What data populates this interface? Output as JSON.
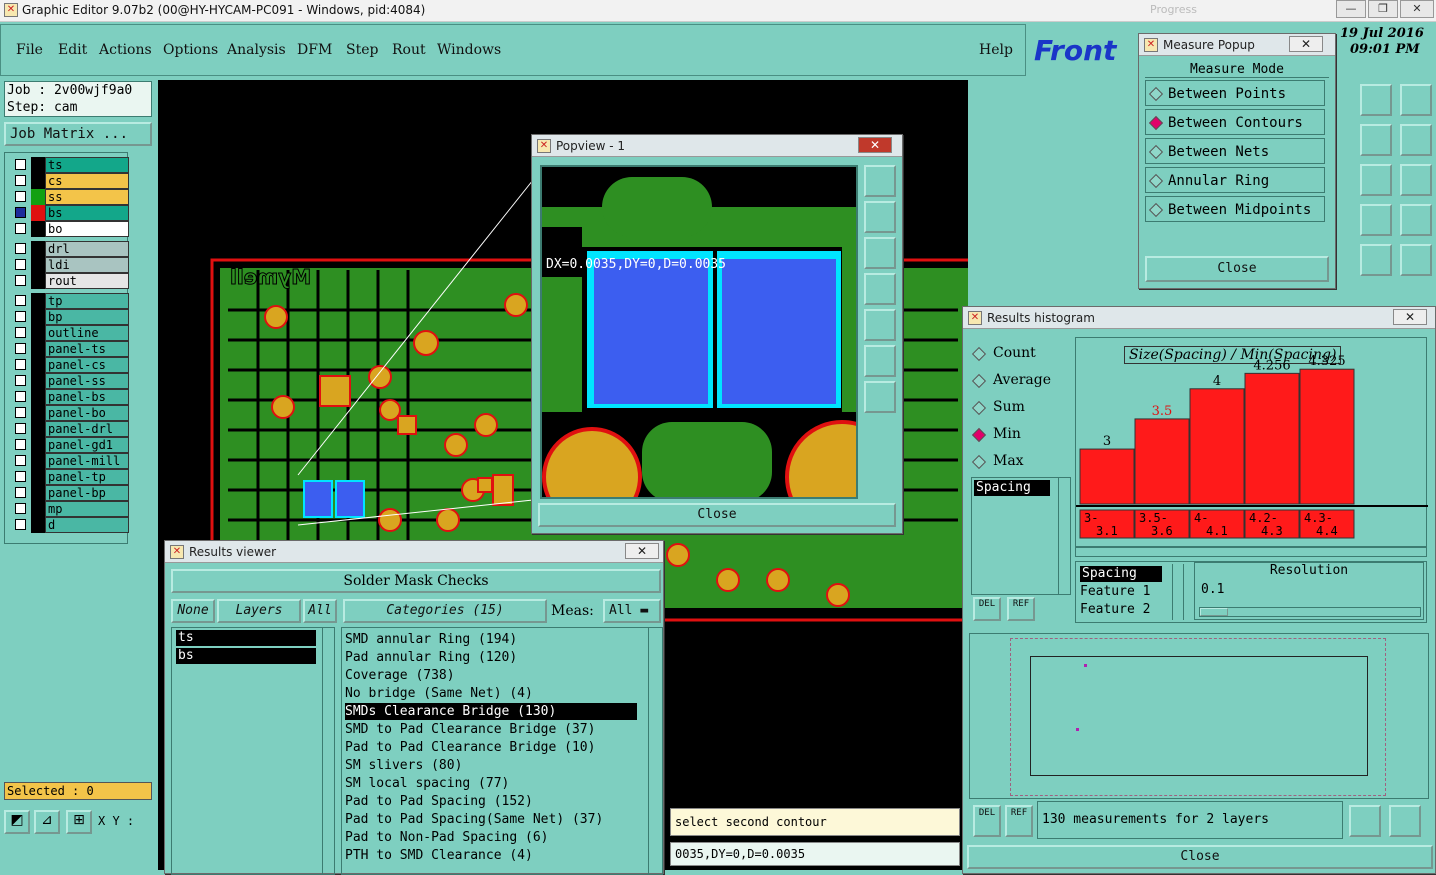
{
  "window": {
    "title": "Graphic Editor 9.07b2 (00@HY-HYCAM-PC091 - Windows, pid:4084)",
    "min": "—",
    "max": "❐",
    "close": "✕",
    "ghost": "Progress"
  },
  "menu": {
    "items": [
      "File",
      "Edit",
      "Actions",
      "Options",
      "Analysis",
      "DFM",
      "Step",
      "Rout",
      "Windows"
    ],
    "help": "Help"
  },
  "brand": {
    "logo": "Front",
    "date": "19 Jul 2016",
    "time": "09:01 PM"
  },
  "job": {
    "job": "Job : 2v00wjf9a0",
    "step": "Step: cam",
    "matrix": "Job Matrix ..."
  },
  "layers": [
    {
      "name": "ts",
      "color": "#13a78a",
      "sw": "#000",
      "checked": false
    },
    {
      "name": "cs",
      "color": "#f3c449",
      "sw": "#000",
      "checked": false
    },
    {
      "name": "ss",
      "color": "#f3c449",
      "sw": "#12a012",
      "checked": false
    },
    {
      "name": "bs",
      "color": "#13a78a",
      "sw": "#e01010",
      "checked": true
    },
    {
      "name": "bo",
      "color": "#ffffff",
      "sw": "#000",
      "checked": false
    },
    {
      "name": "drl",
      "color": "#a9c4c1",
      "sw": "#000",
      "checked": false
    },
    {
      "name": "ldi",
      "color": "#a9c4c1",
      "sw": "#000",
      "checked": false
    },
    {
      "name": "rout",
      "color": "#e6e6e6",
      "sw": "#000",
      "checked": false
    },
    {
      "name": "tp",
      "color": "#4ab7a4",
      "sw": "#000",
      "checked": false
    },
    {
      "name": "bp",
      "color": "#4ab7a4",
      "sw": "#000",
      "checked": false
    },
    {
      "name": "outline",
      "color": "#4ab7a4",
      "sw": "#000",
      "checked": false
    },
    {
      "name": "panel-ts",
      "color": "#4ab7a4",
      "sw": "#000",
      "checked": false
    },
    {
      "name": "panel-cs",
      "color": "#4ab7a4",
      "sw": "#000",
      "checked": false
    },
    {
      "name": "panel-ss",
      "color": "#4ab7a4",
      "sw": "#000",
      "checked": false
    },
    {
      "name": "panel-bs",
      "color": "#4ab7a4",
      "sw": "#000",
      "checked": false
    },
    {
      "name": "panel-bo",
      "color": "#4ab7a4",
      "sw": "#000",
      "checked": false
    },
    {
      "name": "panel-drl",
      "color": "#4ab7a4",
      "sw": "#000",
      "checked": false
    },
    {
      "name": "panel-gd1",
      "color": "#4ab7a4",
      "sw": "#000",
      "checked": false
    },
    {
      "name": "panel-mill",
      "color": "#4ab7a4",
      "sw": "#000",
      "checked": false
    },
    {
      "name": "panel-tp",
      "color": "#4ab7a4",
      "sw": "#000",
      "checked": false
    },
    {
      "name": "panel-bp",
      "color": "#4ab7a4",
      "sw": "#000",
      "checked": false
    },
    {
      "name": "mp",
      "color": "#4ab7a4",
      "sw": "#000",
      "checked": false
    },
    {
      "name": "d",
      "color": "#4ab7a4",
      "sw": "#000",
      "checked": false
    }
  ],
  "status": {
    "selected": "Selected : 0",
    "xy": "X Y :",
    "prompt": "select second contour",
    "readout": "0035,DY=0,D=0.0035"
  },
  "board": {
    "text": "Mymell"
  },
  "popview": {
    "title": "Popview - 1",
    "measure": "DX=0.0035,DY=0,D=0.0035",
    "close": "Close"
  },
  "measure_popup": {
    "title": "Measure Popup",
    "header": "Measure Mode",
    "options": [
      "Between Points",
      "Between Contours",
      "Between Nets",
      "Annular Ring",
      "Between Midpoints"
    ],
    "selected": 1,
    "close": "Close"
  },
  "results_viewer": {
    "title": "Results viewer",
    "heading": "Solder Mask Checks",
    "none": "None",
    "layers_label": "Layers",
    "all": "All",
    "categories": "Categories (15)",
    "meas_label": "Meas:",
    "meas_value": "All",
    "layers": [
      "ts",
      "bs"
    ],
    "items": [
      "SMD annular Ring (194)",
      "Pad annular Ring (120)",
      "Coverage (738)",
      "No bridge (Same Net) (4)",
      "SMDs Clearance Bridge (130)",
      "SMD to Pad Clearance Bridge (37)",
      "Pad to Pad Clearance Bridge (10)",
      "SM slivers (80)",
      "SM local spacing (77)",
      "Pad to Pad Spacing (152)",
      "Pad to Pad Spacing(Same Net) (37)",
      "Pad to Non-Pad Spacing (6)",
      "PTH to SMD Clearance (4)"
    ],
    "selected_item": 4
  },
  "histogram": {
    "title": "Results histogram",
    "options": [
      "Count",
      "Average",
      "Sum",
      "Min",
      "Max"
    ],
    "selected": 3,
    "list": [
      "Spacing"
    ],
    "chart_title": "Size(Spacing) / Min(Spacing)",
    "del": "DEL",
    "ref": "REF",
    "props": [
      "Spacing",
      "Feature 1",
      "Feature 2"
    ],
    "resolution_label": "Resolution",
    "resolution_value": "0.1",
    "summary": "130 measurements for 2 layers",
    "close": "Close"
  },
  "chart_data": {
    "type": "bar",
    "title": "Size(Spacing) / Min(Spacing)",
    "categories": [
      "3-3.1",
      "3.5-3.6",
      "4-4.1",
      "4.2-4.3",
      "4.3-4.4"
    ],
    "category_labels": [
      [
        "3-",
        "3.1"
      ],
      [
        "3.5-",
        "3.6"
      ],
      [
        "4-",
        "4.1"
      ],
      [
        "4.2-",
        "4.3"
      ],
      [
        "4.3-",
        "4.4"
      ]
    ],
    "values": [
      3,
      3.5,
      4,
      4.256,
      4.325
    ],
    "value_labels": [
      "3",
      "3.5",
      "4",
      "4.256",
      "4.325"
    ],
    "highlight_index": 1,
    "bar_color": "#ff1a1a"
  }
}
